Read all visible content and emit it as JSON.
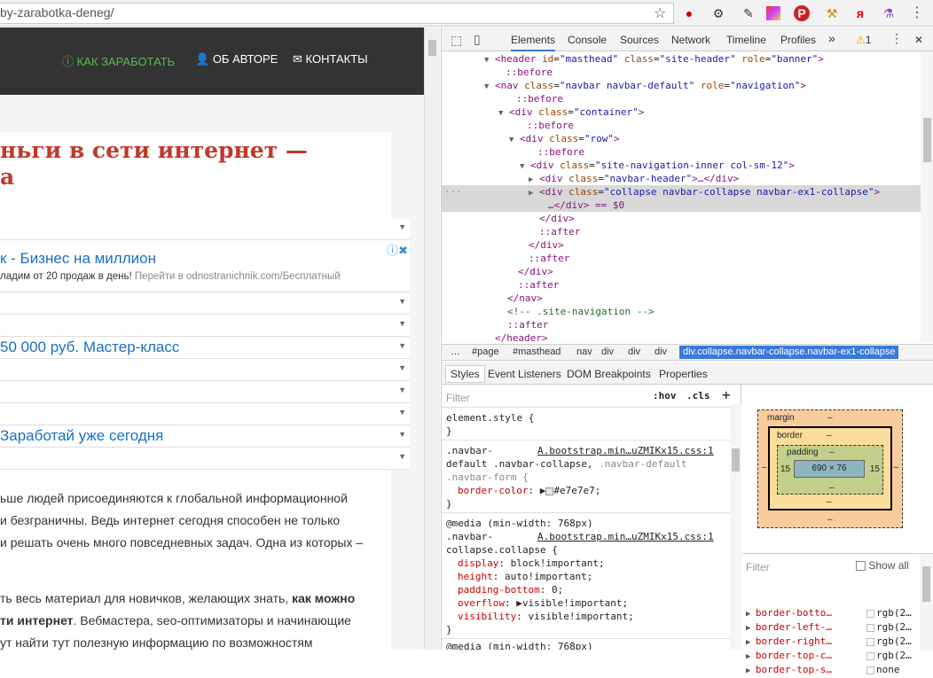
{
  "browser": {
    "url": "by-zarabotka-deneg/",
    "bookmark_icon": "star-icon",
    "extensions": [
      "red-badge-icon",
      "gear-icon",
      "eyedropper-icon",
      "gradient-icon",
      "pinterest-icon",
      "hammer-icon",
      "yandex-icon",
      "potion-icon",
      "menu-dots-icon"
    ],
    "ext_glyphs": {
      "red": "●",
      "gear": "⚙",
      "pen": "✎",
      "pin": "P",
      "ham": "⚒",
      "ya": "я",
      "pot": "⚗",
      "menu": "⋮"
    }
  },
  "site": {
    "nav": [
      {
        "icon": "info-circle-icon",
        "label": "КАК ЗАРАБОТАТЬ",
        "color": "#5cb85c"
      },
      {
        "icon": "user-icon",
        "label": "ОБ АВТОРЕ",
        "color": "#ffffff"
      },
      {
        "icon": "envelope-icon",
        "label": "КОНТАКТЫ",
        "color": "#ffffff"
      }
    ],
    "title_line1": "ньги в сети интернет —",
    "title_line2": "а",
    "ad1_title": "к - Бизнес на миллион",
    "ad1_desc": "ладим от 20 продаж в день! ",
    "ad1_link": "Перейти в odnostranichnik.com/Бесплатный",
    "ad2": "50 000 руб. Мастер-класс",
    "ad3": "Заработай уже сегодня",
    "adchoices": "ⓘ✖",
    "paras": [
      "ьше людей присоединяются к глобальной информационной",
      "и безграничны. Ведь интернет сегодня способен не только",
      "и решать очень много повседневных задач. Одна из которых –"
    ],
    "para4a": "ть весь материал для новичков, желающих знать, ",
    "para4b": "как можно",
    "para5a": "ти интернет",
    "para5b": ". Вебмастера, seo-оптимизаторы и начинающие",
    "para6": "ут найти тут полезную информацию по возможностям"
  },
  "devtools": {
    "tabs": [
      "Elements",
      "Console",
      "Sources",
      "Network",
      "Timeline",
      "Profiles"
    ],
    "more": "»",
    "warning_count": "1",
    "warn_icon": "⚠",
    "inspect_icon": "⬚",
    "device_icon": "▯",
    "kebab": "⋮",
    "close": "✕",
    "elements": [
      [
        "▼",
        "<header",
        "id",
        "masthead",
        "class",
        "site-header",
        "role",
        "banner"
      ],
      [
        "",
        "::before"
      ],
      [
        "▼",
        "<nav",
        "class",
        "navbar navbar-default",
        "role",
        "navigation"
      ],
      [
        "",
        "::before"
      ],
      [
        "▼",
        "<div",
        "class",
        "container"
      ],
      [
        "",
        "::before"
      ],
      [
        "▼",
        "<div",
        "class",
        "row"
      ],
      [
        "",
        "::before"
      ],
      [
        "▼",
        "<div",
        "class",
        "site-navigation-inner col-sm-12"
      ],
      [
        "▶",
        "<div",
        "class",
        "navbar-header",
        "…</div>"
      ],
      [
        "▶",
        "<div",
        "class",
        "collapse navbar-collapse navbar-ex1-collapse"
      ],
      [
        "",
        "…</div> == $0"
      ],
      [
        "",
        "</div>"
      ],
      [
        "",
        "::after"
      ],
      [
        "",
        "</div>"
      ],
      [
        "",
        "::after"
      ],
      [
        "",
        "</div>"
      ],
      [
        "",
        "::after"
      ],
      [
        "",
        "</nav>"
      ],
      [
        "",
        "<!-- .site-navigation -->"
      ],
      [
        "",
        "::after"
      ],
      [
        "",
        "</header>"
      ]
    ],
    "crumbs": [
      "…",
      "#page",
      "#masthead",
      "nav",
      "div",
      "div",
      "div",
      "div.collapse.navbar-collapse.navbar-ex1-collapse"
    ],
    "style_tabs": [
      "Styles",
      "Event Listeners",
      "DOM Breakpoints",
      "Properties"
    ],
    "filter": "Filter",
    "hov": ":hov",
    "cls": ".cls",
    "plus": "+",
    "rules": {
      "element_style": "element.style {",
      "close": "}",
      "r1_sel1": ".navbar-",
      "r1_src": "A.bootstrap.min…uZMIKx15.css:1",
      "r1_sel2": "default .navbar-collapse, ",
      "r1_sel2b": ".navbar-default",
      "r1_sel3": ".navbar-form {",
      "r1_prop": "border-color",
      "r1_val": "#e7e7e7;",
      "r1_swatch": "#e7e7e7",
      "r2_media": "@media (min-width: 768px)",
      "r2_sel1": ".navbar-",
      "r2_src": "A.bootstrap.min…uZMIKx15.css:1",
      "r2_sel2": "collapse.collapse {",
      "r2_props": [
        [
          "display",
          "block!important;"
        ],
        [
          "height",
          "auto!important;"
        ],
        [
          "padding-bottom",
          "0;"
        ],
        [
          "overflow",
          "▶visible!important;"
        ],
        [
          "visibility",
          "visible!important;"
        ]
      ],
      "r3_media": "@media (min-width: 768px)"
    },
    "boxmodel": {
      "margin": "margin",
      "border": "border",
      "padding": "padding",
      "dash": "–",
      "content": "690 × 76",
      "pad_left": "15",
      "pad_right": "15"
    },
    "computed_filter": "Filter",
    "show_all": "Show all",
    "computed": [
      [
        "border-botto…",
        "rgb(2…"
      ],
      [
        "border-left-…",
        "rgb(2…"
      ],
      [
        "border-right…",
        "rgb(2…"
      ],
      [
        "border-top-c…",
        "rgb(2…"
      ],
      [
        "border-top-s…",
        "none"
      ]
    ]
  }
}
